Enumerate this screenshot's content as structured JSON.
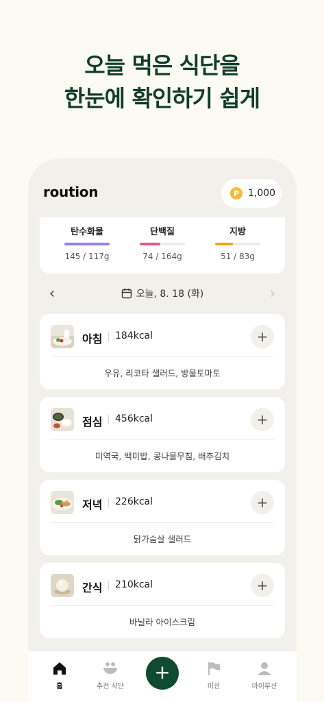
{
  "headline": {
    "line1": "오늘 먹은 식단을",
    "line2": "한눈에 확인하기 쉽게"
  },
  "app": {
    "logo": "roution",
    "points_icon": "P",
    "points": "1,000"
  },
  "macros": [
    {
      "name": "탄수화물",
      "value": "145 / 117g",
      "progress": 1.0,
      "color": "#9a7ef0"
    },
    {
      "name": "단백질",
      "value": "74 / 164g",
      "progress": 0.45,
      "color": "#e8578e"
    },
    {
      "name": "지방",
      "value": "51 / 83g",
      "progress": 0.4,
      "color": "#f1a21a"
    }
  ],
  "date": {
    "label": "오늘, 8. 18 (화)",
    "prev_icon": "chevron-left-icon",
    "next_icon": "chevron-right-icon",
    "calendar_icon": "calendar-icon"
  },
  "meals": [
    {
      "name": "아침",
      "kcal": "184kcal",
      "foods": "우유, 리코타 샐러드, 방울토마토"
    },
    {
      "name": "점심",
      "kcal": "456kcal",
      "foods": "미역국, 백미밥, 콩나물무침, 배추김치"
    },
    {
      "name": "저녁",
      "kcal": "226kcal",
      "foods": "닭가슴살 샐러드"
    },
    {
      "name": "간식",
      "kcal": "210kcal",
      "foods": "바닐라 아이스크림"
    }
  ],
  "add_symbol": "+",
  "tabs": [
    {
      "label": "홈",
      "icon": "home-icon"
    },
    {
      "label": "추천 식단",
      "icon": "bowl-icon"
    },
    {
      "label": "미션",
      "icon": "flag-icon"
    },
    {
      "label": "마이루션",
      "icon": "person-icon"
    }
  ],
  "fab_symbol": "+",
  "colors": {
    "brand": "#0f4a33",
    "headline": "#123d2b",
    "background": "#fbfaf3",
    "coin": "#f6b93a"
  }
}
